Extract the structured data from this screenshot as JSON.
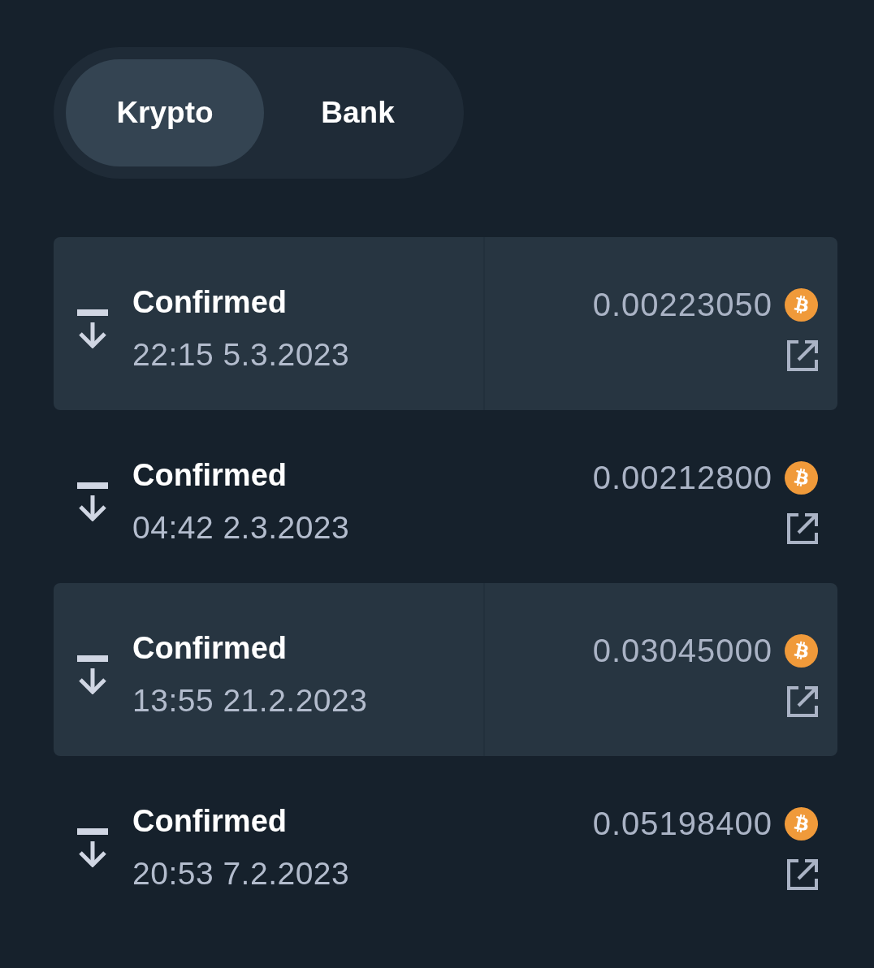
{
  "tabs": [
    {
      "label": "Krypto",
      "selected": true
    },
    {
      "label": "Bank",
      "selected": false
    }
  ],
  "transactions": [
    {
      "status": "Confirmed",
      "datetime": "22:15 5.3.2023",
      "amount": "0.00223050"
    },
    {
      "status": "Confirmed",
      "datetime": "04:42 2.3.2023",
      "amount": "0.00212800"
    },
    {
      "status": "Confirmed",
      "datetime": "13:55 21.2.2023",
      "amount": "0.03045000"
    },
    {
      "status": "Confirmed",
      "datetime": "20:53 7.2.2023",
      "amount": "0.05198400"
    }
  ]
}
